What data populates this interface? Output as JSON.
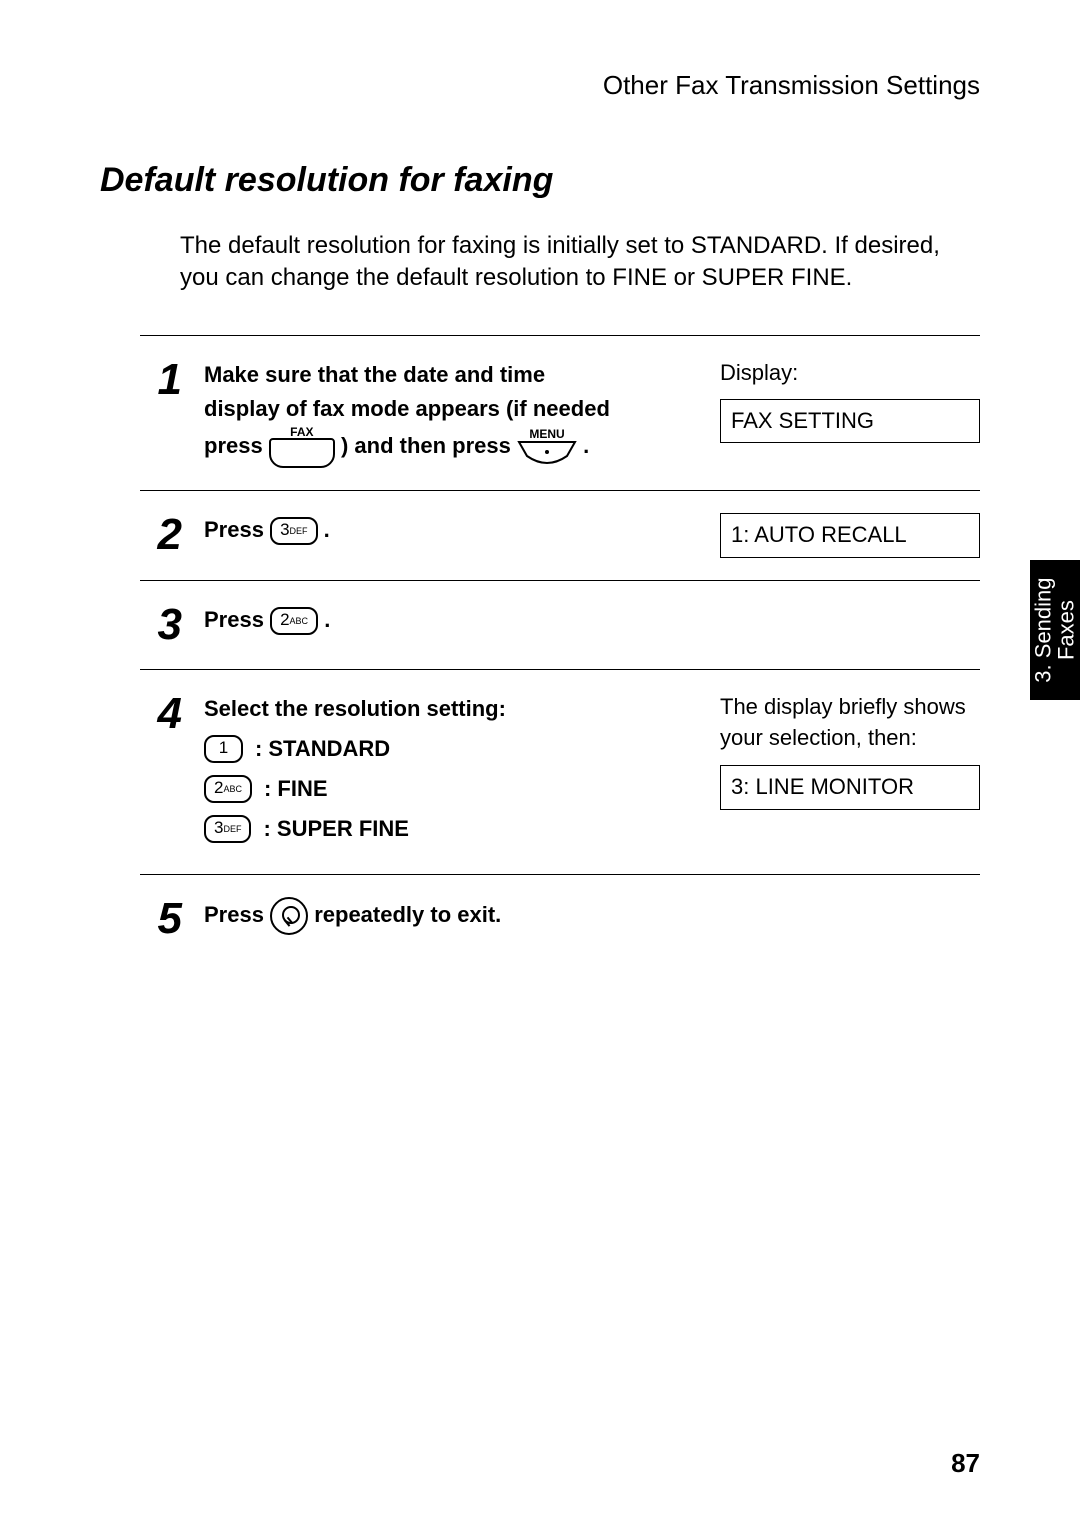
{
  "runningHead": "Other Fax Transmission Settings",
  "sectionTitle": "Default resolution for faxing",
  "intro": "The default resolution for faxing is initially set to STANDARD.  If desired, you can change the default resolution to FINE or SUPER FINE.",
  "steps": {
    "s1": {
      "num": "1",
      "textA": "Make sure that the date and time",
      "textB": "display of fax mode appears (if needed",
      "press": "press",
      "andThenPress": ") and then press",
      "period": ".",
      "faxLabel": "FAX",
      "menuLabel": "MENU",
      "displayLabel": "Display:",
      "lcd": "FAX SETTING"
    },
    "s2": {
      "num": "2",
      "press": "Press",
      "key": "3",
      "keySub": "DEF",
      "period": ".",
      "lcd": "1: AUTO RECALL"
    },
    "s3": {
      "num": "3",
      "press": "Press",
      "key": "2",
      "keySub": "ABC",
      "period": "."
    },
    "s4": {
      "num": "4",
      "lead": "Select the resolution setting:",
      "opt1Key": "1",
      "opt1Label": ": STANDARD",
      "opt2Key": "2",
      "opt2KeySub": "ABC",
      "opt2Label": ": FINE",
      "opt3Key": "3",
      "opt3KeySub": "DEF",
      "opt3Label": ": SUPER FINE",
      "sideNote": "The display briefly shows your selection, then:",
      "lcd": "3: LINE MONITOR"
    },
    "s5": {
      "num": "5",
      "press": "Press",
      "tail": "repeatedly to exit."
    }
  },
  "thumbTab": "3. Sending\nFaxes",
  "pageNumber": "87"
}
